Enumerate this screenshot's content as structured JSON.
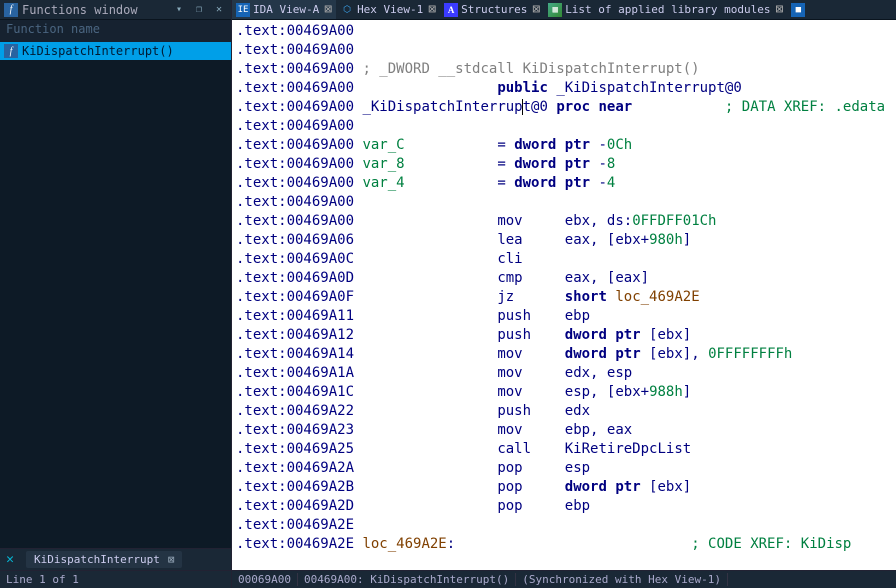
{
  "left": {
    "title": "Functions window",
    "filter_placeholder": "Function name",
    "items": [
      {
        "name": "KiDispatchInterrupt()"
      }
    ],
    "bottom_tab": "KiDispatchInterrupt",
    "status": "Line 1 of 1"
  },
  "tabs": [
    {
      "icon": "ida",
      "label": "IDA View-A",
      "active": true
    },
    {
      "icon": "hex",
      "label": "Hex View-1"
    },
    {
      "icon": "str",
      "label": "Structures"
    },
    {
      "icon": "lib",
      "label": "List of applied library modules"
    }
  ],
  "disasm": {
    "addr_prefix": ".text:",
    "lines": [
      {
        "a": "00469A00",
        "body": []
      },
      {
        "a": "00469A00",
        "body": []
      },
      {
        "a": "00469A00",
        "body": [
          {
            "t": "cmt",
            "s": " ; _DWORD __stdcall KiDispatchInterrupt()"
          }
        ]
      },
      {
        "a": "00469A00",
        "body": [
          {
            "t": "sp",
            "s": "                 "
          },
          {
            "t": "kw",
            "s": "public"
          },
          {
            "t": "s",
            "s": " "
          },
          {
            "t": "ident",
            "s": "_KiDispatchInterrupt@0"
          }
        ]
      },
      {
        "a": "00469A00",
        "body": [
          {
            "t": "s",
            "s": " "
          },
          {
            "t": "proc",
            "s": "_KiDispatchInterrup"
          },
          {
            "t": "cur",
            "s": ""
          },
          {
            "t": "proc",
            "s": "t@0"
          },
          {
            "t": "s",
            "s": " "
          },
          {
            "t": "kw",
            "s": "proc near"
          },
          {
            "t": "sp",
            "s": "           "
          },
          {
            "t": "xref",
            "s": "; DATA XREF: .edata"
          }
        ]
      },
      {
        "a": "00469A00",
        "body": []
      },
      {
        "a": "00469A00",
        "body": [
          {
            "t": "s",
            "s": " "
          },
          {
            "t": "var",
            "s": "var_C"
          },
          {
            "t": "sp",
            "s": "           "
          },
          {
            "t": "s",
            "s": "= "
          },
          {
            "t": "kw",
            "s": "dword ptr"
          },
          {
            "t": "s",
            "s": " -"
          },
          {
            "t": "num",
            "s": "0Ch"
          }
        ]
      },
      {
        "a": "00469A00",
        "body": [
          {
            "t": "s",
            "s": " "
          },
          {
            "t": "var",
            "s": "var_8"
          },
          {
            "t": "sp",
            "s": "           "
          },
          {
            "t": "s",
            "s": "= "
          },
          {
            "t": "kw",
            "s": "dword ptr"
          },
          {
            "t": "s",
            "s": " -"
          },
          {
            "t": "num",
            "s": "8"
          }
        ]
      },
      {
        "a": "00469A00",
        "body": [
          {
            "t": "s",
            "s": " "
          },
          {
            "t": "var",
            "s": "var_4"
          },
          {
            "t": "sp",
            "s": "           "
          },
          {
            "t": "s",
            "s": "= "
          },
          {
            "t": "kw",
            "s": "dword ptr"
          },
          {
            "t": "s",
            "s": " -"
          },
          {
            "t": "num",
            "s": "4"
          }
        ]
      },
      {
        "a": "00469A00",
        "body": []
      },
      {
        "a": "00469A00",
        "body": [
          {
            "t": "sp",
            "s": "                 "
          },
          {
            "t": "inst",
            "s": "mov"
          },
          {
            "t": "sp",
            "s": "     "
          },
          {
            "t": "s",
            "s": "ebx, ds:"
          },
          {
            "t": "num",
            "s": "0FFDFF01Ch"
          }
        ]
      },
      {
        "a": "00469A06",
        "body": [
          {
            "t": "sp",
            "s": "                 "
          },
          {
            "t": "inst",
            "s": "lea"
          },
          {
            "t": "sp",
            "s": "     "
          },
          {
            "t": "s",
            "s": "eax, [ebx+"
          },
          {
            "t": "num",
            "s": "980h"
          },
          {
            "t": "s",
            "s": "]"
          }
        ]
      },
      {
        "a": "00469A0C",
        "body": [
          {
            "t": "sp",
            "s": "                 "
          },
          {
            "t": "inst",
            "s": "cli"
          }
        ]
      },
      {
        "a": "00469A0D",
        "body": [
          {
            "t": "sp",
            "s": "                 "
          },
          {
            "t": "inst",
            "s": "cmp"
          },
          {
            "t": "sp",
            "s": "     "
          },
          {
            "t": "s",
            "s": "eax, [eax]"
          }
        ]
      },
      {
        "a": "00469A0F",
        "body": [
          {
            "t": "sp",
            "s": "                 "
          },
          {
            "t": "inst",
            "s": "jz"
          },
          {
            "t": "sp",
            "s": "      "
          },
          {
            "t": "kw",
            "s": "short"
          },
          {
            "t": "s",
            "s": " "
          },
          {
            "t": "loc",
            "s": "loc_469A2E"
          }
        ]
      },
      {
        "a": "00469A11",
        "body": [
          {
            "t": "sp",
            "s": "                 "
          },
          {
            "t": "inst",
            "s": "push"
          },
          {
            "t": "sp",
            "s": "    "
          },
          {
            "t": "s",
            "s": "ebp"
          }
        ]
      },
      {
        "a": "00469A12",
        "body": [
          {
            "t": "sp",
            "s": "                 "
          },
          {
            "t": "inst",
            "s": "push"
          },
          {
            "t": "sp",
            "s": "    "
          },
          {
            "t": "kw",
            "s": "dword ptr"
          },
          {
            "t": "s",
            "s": " [ebx]"
          }
        ]
      },
      {
        "a": "00469A14",
        "body": [
          {
            "t": "sp",
            "s": "                 "
          },
          {
            "t": "inst",
            "s": "mov"
          },
          {
            "t": "sp",
            "s": "     "
          },
          {
            "t": "kw",
            "s": "dword ptr"
          },
          {
            "t": "s",
            "s": " [ebx], "
          },
          {
            "t": "num",
            "s": "0FFFFFFFFh"
          }
        ]
      },
      {
        "a": "00469A1A",
        "body": [
          {
            "t": "sp",
            "s": "                 "
          },
          {
            "t": "inst",
            "s": "mov"
          },
          {
            "t": "sp",
            "s": "     "
          },
          {
            "t": "s",
            "s": "edx, esp"
          }
        ]
      },
      {
        "a": "00469A1C",
        "body": [
          {
            "t": "sp",
            "s": "                 "
          },
          {
            "t": "inst",
            "s": "mov"
          },
          {
            "t": "sp",
            "s": "     "
          },
          {
            "t": "s",
            "s": "esp, [ebx+"
          },
          {
            "t": "num",
            "s": "988h"
          },
          {
            "t": "s",
            "s": "]"
          }
        ]
      },
      {
        "a": "00469A22",
        "body": [
          {
            "t": "sp",
            "s": "                 "
          },
          {
            "t": "inst",
            "s": "push"
          },
          {
            "t": "sp",
            "s": "    "
          },
          {
            "t": "s",
            "s": "edx"
          }
        ]
      },
      {
        "a": "00469A23",
        "body": [
          {
            "t": "sp",
            "s": "                 "
          },
          {
            "t": "inst",
            "s": "mov"
          },
          {
            "t": "sp",
            "s": "     "
          },
          {
            "t": "s",
            "s": "ebp, eax"
          }
        ]
      },
      {
        "a": "00469A25",
        "body": [
          {
            "t": "sp",
            "s": "                 "
          },
          {
            "t": "inst",
            "s": "call"
          },
          {
            "t": "sp",
            "s": "    "
          },
          {
            "t": "ident",
            "s": "KiRetireDpcList"
          }
        ]
      },
      {
        "a": "00469A2A",
        "body": [
          {
            "t": "sp",
            "s": "                 "
          },
          {
            "t": "inst",
            "s": "pop"
          },
          {
            "t": "sp",
            "s": "     "
          },
          {
            "t": "s",
            "s": "esp"
          }
        ]
      },
      {
        "a": "00469A2B",
        "body": [
          {
            "t": "sp",
            "s": "                 "
          },
          {
            "t": "inst",
            "s": "pop"
          },
          {
            "t": "sp",
            "s": "     "
          },
          {
            "t": "kw",
            "s": "dword ptr"
          },
          {
            "t": "s",
            "s": " [ebx]"
          }
        ]
      },
      {
        "a": "00469A2D",
        "body": [
          {
            "t": "sp",
            "s": "                 "
          },
          {
            "t": "inst",
            "s": "pop"
          },
          {
            "t": "sp",
            "s": "     "
          },
          {
            "t": "s",
            "s": "ebp"
          }
        ]
      },
      {
        "a": "00469A2E",
        "body": []
      },
      {
        "a": "00469A2E",
        "body": [
          {
            "t": "s",
            "s": " "
          },
          {
            "t": "loc",
            "s": "loc_469A2E"
          },
          {
            "t": "s",
            "s": ":"
          },
          {
            "t": "sp",
            "s": "                            "
          },
          {
            "t": "xref",
            "s": "; CODE XREF: KiDisp"
          }
        ]
      }
    ]
  },
  "right_status": {
    "off": "00069A00",
    "addr": "00469A00: KiDispatchInterrupt()",
    "sync": "(Synchronized with Hex View-1)"
  },
  "watermark": ""
}
